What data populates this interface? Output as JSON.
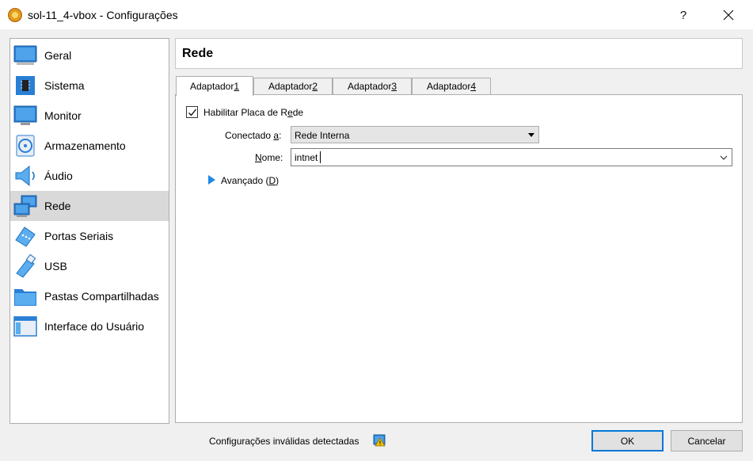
{
  "window": {
    "title": "sol-11_4-vbox - Configurações",
    "help": "?"
  },
  "sidebar": {
    "items": [
      {
        "label": "Geral",
        "icon": "general-icon"
      },
      {
        "label": "Sistema",
        "icon": "system-icon"
      },
      {
        "label": "Monitor",
        "icon": "display-icon"
      },
      {
        "label": "Armazenamento",
        "icon": "storage-icon"
      },
      {
        "label": "Áudio",
        "icon": "audio-icon"
      },
      {
        "label": "Rede",
        "icon": "network-icon",
        "selected": true
      },
      {
        "label": "Portas Seriais",
        "icon": "serial-port-icon"
      },
      {
        "label": "USB",
        "icon": "usb-icon"
      },
      {
        "label": "Pastas Compartilhadas",
        "icon": "shared-folder-icon"
      },
      {
        "label": "Interface do Usuário",
        "icon": "user-interface-icon"
      }
    ]
  },
  "section": {
    "title": "Rede"
  },
  "tabs": [
    {
      "label": "Adaptador ",
      "key": "1",
      "active": true
    },
    {
      "label": "Adaptador ",
      "key": "2"
    },
    {
      "label": "Adaptador ",
      "key": "3"
    },
    {
      "label": "Adaptador ",
      "key": "4"
    }
  ],
  "adapter": {
    "enable_label_pre": "Habilitar Placa de R",
    "enable_label_key": "e",
    "enable_label_post": "de",
    "enabled": true,
    "attached_label_pre": "Conectado ",
    "attached_label_key": "a",
    "attached_label_post": ":",
    "attached_value": "Rede Interna",
    "name_label_key": "N",
    "name_label_post": "ome:",
    "name_value": "intnet",
    "advanced_label_pre": "Avançado (",
    "advanced_label_key": "D",
    "advanced_label_post": ")"
  },
  "footer": {
    "status": "Configurações inválidas detectadas",
    "ok_label": "OK",
    "cancel_label": "Cancelar"
  },
  "colors": {
    "accent": "#0078d7",
    "selected_bg": "#d9d9d9",
    "icon_blue": "#1e88e5"
  }
}
